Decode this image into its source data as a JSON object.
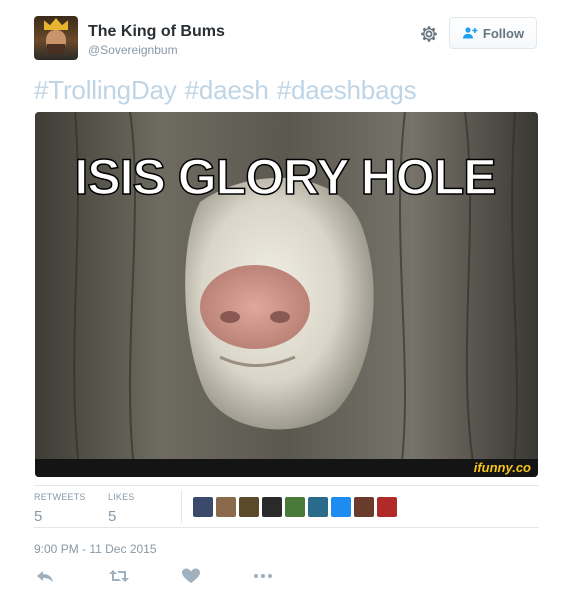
{
  "user": {
    "name": "The King of Bums",
    "handle": "@Sovereignbum"
  },
  "follow_button": {
    "label": "Follow"
  },
  "tweet": {
    "hashtags": [
      "#TrollingDay",
      "#daesh",
      "#daeshbags"
    ]
  },
  "media": {
    "caption": "ISIS GLORY HOLE",
    "watermark": "ifunny.co"
  },
  "stats": {
    "retweets_label": "RETWEETS",
    "retweets_count": "5",
    "likes_label": "LIKES",
    "likes_count": "5"
  },
  "likers": [
    {
      "icon": "liker-avatar",
      "color": "#3b4a6b"
    },
    {
      "icon": "liker-avatar",
      "color": "#8a6a4a"
    },
    {
      "icon": "liker-avatar",
      "color": "#5a4a2a"
    },
    {
      "icon": "liker-avatar",
      "color": "#2a2a2a"
    },
    {
      "icon": "liker-avatar",
      "color": "#4a7a3a"
    },
    {
      "icon": "liker-avatar",
      "color": "#2a6a8a"
    },
    {
      "icon": "liker-avatar",
      "color": "#1d8cf0"
    },
    {
      "icon": "liker-avatar",
      "color": "#6a3a2a"
    },
    {
      "icon": "liker-avatar",
      "color": "#b02a2a"
    }
  ],
  "timestamp": "9:00 PM - 11 Dec 2015",
  "icons": {
    "settings": "gear-icon",
    "follow": "add-user-icon",
    "reply": "reply-icon",
    "retweet": "retweet-icon",
    "like": "heart-icon",
    "more": "more-icon"
  },
  "colors": {
    "hashtag": "#bfd5e6",
    "muted": "#8899a6",
    "accent_blue": "#1da1f2",
    "watermark": "#f5c518"
  }
}
